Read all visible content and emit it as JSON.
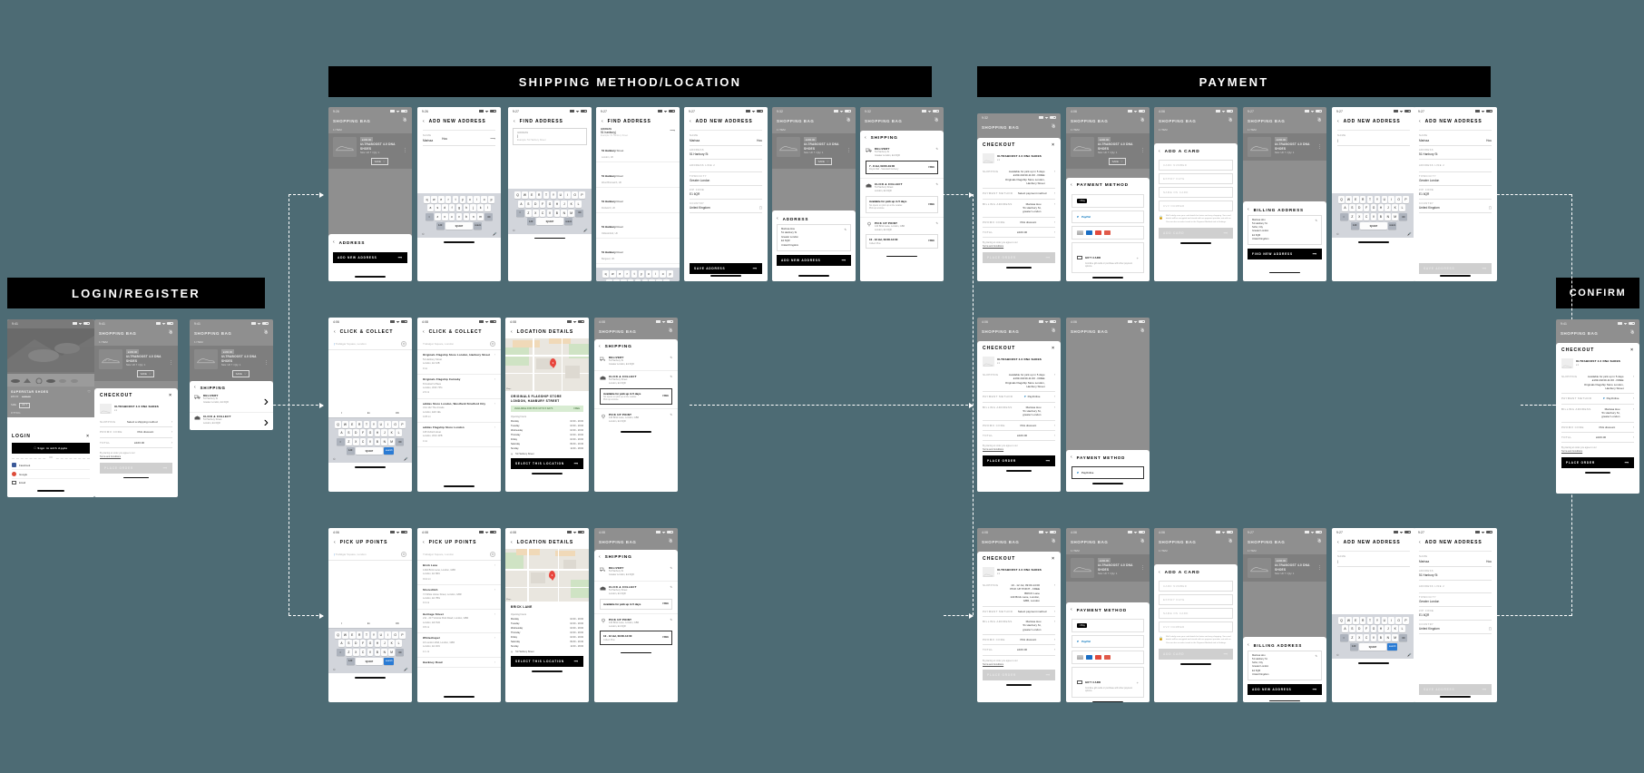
{
  "meta": {
    "canvas_bg": "#4d6b74",
    "accent": "#000000"
  },
  "banners": [
    {
      "id": "login",
      "label": "LOGIN/REGISTER"
    },
    {
      "id": "shipping",
      "label": "SHIPPING METHOD/LOCATION"
    },
    {
      "id": "payment",
      "label": "PAYMENT"
    },
    {
      "id": "confirm",
      "label": "CONFIRM"
    }
  ],
  "status_bar": {
    "time_a": "9:41",
    "time_b": "9:26",
    "time_c": "9:27",
    "time_d": "9:32",
    "time_e": "4:06",
    "time_f": "4:08",
    "carrier": "App Store"
  },
  "product": {
    "name": "ULTRABOOST 4.0 DNA SHOES",
    "price": "£160.00",
    "size": "x1",
    "meta": "Size: UK 7 / Qty: 1",
    "save_label": "SAVE"
  },
  "bag": {
    "title": "SHOPPING BAG",
    "items_count": "1 ITEM"
  },
  "pdp": {
    "title": "SUPERSTAR SHOES",
    "price": "£80.00",
    "strike": "£100.00",
    "size_label": "SIZE",
    "size_value": "UK 7",
    "fitting": "FITTING"
  },
  "login": {
    "title": "LOGIN",
    "apple_button": "Sign in with Apple",
    "or": "OR",
    "options": [
      "Facebook",
      "Google",
      "Email"
    ]
  },
  "checkout": {
    "title": "CHECKOUT",
    "rows": [
      {
        "label": "SHIPPING",
        "value": "Select a shipping method"
      },
      {
        "label": "PROMO CODE",
        "value": "Pick discount"
      },
      {
        "label": "TOTAL",
        "value": "£160.00"
      }
    ],
    "terms_note": "By placing an order you agree to our",
    "terms_link": "Terms and Conditions",
    "place_order": "PLACE ORDER",
    "shipping_selected": "Available for pick up in 5 days\n£199.4/2/40-11:00 - FREE\nOriginals Flagship Store London,\nHanbury Street",
    "payment_method_placeholder": "Select payment method",
    "payment_method_value": "PayOnline",
    "billing_address": "Marissa Hou\n51 Hanbury St,\ngreater London",
    "shipping_pickup": "10 - 12 Jul, 09:00-14:00\nPICK UP POINT - FREE\nBRICK Lane\n140 Brick Lane, London,\nGBR, London"
  },
  "address_sheet": {
    "title": "ADDRESS",
    "add_button": "ADD NEW ADDRESS",
    "saved": "Marissa Hou\n51 Hanbury St\nGreater London\nE1 6QR\nUnited Kingdom"
  },
  "add_address": {
    "title": "ADD NEW ADDRESS",
    "save_button": "SAVE ADDRESS",
    "fields": [
      {
        "label": "NAME",
        "value": "Marissa",
        "value2": "Hou"
      },
      {
        "label": "ADDRESS",
        "value": "51 Hanbury St"
      },
      {
        "label": "ADDRESS LINE 2",
        "value": ""
      },
      {
        "label": "TOWN/CITY",
        "value": "Greater London"
      },
      {
        "label": "ZIP CODE",
        "value": "E1 6QR"
      },
      {
        "label": "COUNTRY",
        "value": "United Kingdom"
      }
    ]
  },
  "find_address": {
    "title": "FIND ADDRESS",
    "field_label": "ADDRESS",
    "placeholder": "Example: 51 Hanbury Street",
    "typed": "51 hanbury",
    "suggestions": [
      {
        "bold": "51 Hanbury",
        "rest": " Street",
        "sub": "London, UK"
      },
      {
        "bold": "51 Hanbury",
        "rest": " Road",
        "sub": "West Bromwich, UK"
      },
      {
        "bold": "51 Hanbury",
        "rest": " Road",
        "sub": "Droitwich, UK"
      },
      {
        "bold": "51 Hanbury",
        "rest": " Road",
        "sub": "Oldswinford, UK"
      },
      {
        "bold": "51 Hanbury",
        "rest": " Road",
        "sub": "Bargoed, UK"
      }
    ]
  },
  "shipping_sheet": {
    "title": "SHIPPING",
    "options": [
      {
        "icon": "truck-icon",
        "name": "DELIVERY",
        "sub": "51 Hanbury St\nGreater London, E1 6QR",
        "box_title": "7 - 8 Jul, 09:00-19:00",
        "box_sub": "Royal Mail - Standard Delivery",
        "price": "FREE",
        "selected": true
      },
      {
        "icon": "store-icon",
        "name": "CLICK & COLLECT",
        "sub": "51 Hanbury Street\nLondon, E1 6QR",
        "box_title": "Available for pick up in 5 days",
        "box_sub": "No opens on pick up at the retailer.\nPick up at store.",
        "price": "FREE",
        "selected": false
      },
      {
        "icon": "pin-icon",
        "name": "PICK UP POINT",
        "sub": "140 Brick Lane, London, GBR\nLondon, E1 6QR",
        "box_title": "10 - 12 Jul, 09:00-14:00",
        "box_sub": "Collect Plus",
        "price": "FREE",
        "selected": false
      }
    ]
  },
  "click_collect": {
    "title": "CLICK & COLLECT",
    "search_placeholder": "Trafalgar Square, London",
    "stores": [
      {
        "name": "Originals Flagship Store London, Hanbury Street",
        "addr": "51 Hanbury Street\nLondon, E1 6JB",
        "dist": "0 mi"
      },
      {
        "name": "Originals Flagship Carnaby",
        "addr": "8 Foubert's Place\nLondon, W1F 7PG",
        "dist": "2.9 mi"
      },
      {
        "name": "adidas Store London, Westfield Stratford City",
        "addr": "Unit 142 The Arcade\nLondon, E20 1EL",
        "dist": "3.25 mi"
      },
      {
        "name": "adidas Flagship Store London",
        "addr": "415 Oxford street\nLondon, W1C 2PB",
        "dist": "4 mi"
      }
    ]
  },
  "pickup_points": {
    "title": "PICK UP POINTS",
    "search_placeholder": "Trafalgar Square, London",
    "points": [
      {
        "name": "Brick Lane",
        "addr": "140A Brick Lane, London, GBR\nLondon, E1 6RU",
        "dist": "0.12 mi"
      },
      {
        "name": "Shoreditch",
        "addr": "71 White Horse Street, London, GBR\nLondon, E1 7BG",
        "dist": "0.4 mi"
      },
      {
        "name": "Heritage Street",
        "addr": "211 - 217 Victoria Park Road, London, GBR\nLondon, E9 7HD",
        "dist": "0.8 mi"
      },
      {
        "name": "Whitechapel",
        "addr": "16 London Wall, London, GBR\nLondon, E1 1DU",
        "dist": "1.1 mi"
      },
      {
        "name": "Hackney Road",
        "addr": "",
        "dist": ""
      }
    ]
  },
  "location_details": {
    "title": "LOCATION DETAILS",
    "store_name": "ORIGINALS FLAGSHIP STORE\nLONDON, HANBURY STREET",
    "pickup_name": "BRICK LANE",
    "availability": "AVAILABLE FOR PICK UP IN 5 DAYS",
    "availability_price": "FREE",
    "opening_label": "Opening hours",
    "hours": [
      {
        "day": "Monday",
        "time": "10:00 - 19:00"
      },
      {
        "day": "Tuesday",
        "time": "10:00 - 19:00"
      },
      {
        "day": "Wednesday",
        "time": "10:00 - 19:00"
      },
      {
        "day": "Thursday",
        "time": "10:00 - 19:00"
      },
      {
        "day": "Friday",
        "time": "10:00 - 19:00"
      },
      {
        "day": "Saturday",
        "time": "09:30 - 19:30"
      },
      {
        "day": "Sunday",
        "time": "11:00 - 18:00"
      }
    ],
    "address": "51 Hanbury Street",
    "cta": "SELECT THIS LOCATION"
  },
  "payment_method": {
    "title": "PAYMENT METHOD",
    "tiles": [
      {
        "type": "applepay",
        "label": "Pay"
      },
      {
        "type": "paypal",
        "label": "PayPal"
      },
      {
        "type": "cards",
        "label": ""
      },
      {
        "type": "giftcard",
        "label": "GIFT CARD",
        "sub": "Combine gift cards or purchase with other payment options."
      }
    ],
    "add_card_cta": "FIND NEW ADDRESS"
  },
  "add_card": {
    "title": "ADD A CARD",
    "fields": [
      "CARD NUMBER",
      "EXPIRY DATE",
      "NAME ON CARD",
      "CVV NUMBER"
    ],
    "note": "We'll safely save your card details for faster and easy shopping. Your card details will be encrypted and stored with our payment provider, not with us. You can also re-select cards in the Payment Methods tab in Settings.",
    "cta": "ADD CARD"
  },
  "billing_address": {
    "title": "BILLING ADDRESS",
    "saved": "Marissa Hou\n51 Hanbury St.\nSoho, City\nGreater London\nE1 6QR\nUnited Kingdom",
    "add_button": "ADD NEW ADDRESS",
    "find_button": "FIND NEW ADDRESS"
  },
  "keyboard": {
    "rows": [
      [
        "q",
        "w",
        "e",
        "r",
        "t",
        "y",
        "u",
        "i",
        "o",
        "p"
      ],
      [
        "a",
        "s",
        "d",
        "f",
        "g",
        "h",
        "j",
        "k",
        "l"
      ],
      [
        "z",
        "x",
        "c",
        "v",
        "b",
        "n",
        "m"
      ]
    ],
    "rows_upper": [
      [
        "Q",
        "W",
        "E",
        "R",
        "T",
        "Y",
        "U",
        "I",
        "O",
        "P"
      ],
      [
        "A",
        "S",
        "D",
        "F",
        "G",
        "H",
        "J",
        "K",
        "L"
      ],
      [
        "Z",
        "X",
        "C",
        "V",
        "B",
        "N",
        "M"
      ]
    ],
    "shift": "⇧",
    "backspace": "⌫",
    "numbers": "123",
    "space": "space",
    "return": "return",
    "search": "search",
    "emoji": "☺",
    "mic": "⌘",
    "predictions": [
      "I",
      "Im",
      "Oh"
    ]
  },
  "icons": {
    "profile": "profile-icon",
    "close": "close-icon",
    "back_chevron": "‹",
    "forward_chevron": "›",
    "arrow_right": "⟶",
    "pencil": "✎",
    "heart": "♡",
    "dots": "⋮",
    "lock": "⚿",
    "trash": "⌧",
    "search": "⌕"
  }
}
